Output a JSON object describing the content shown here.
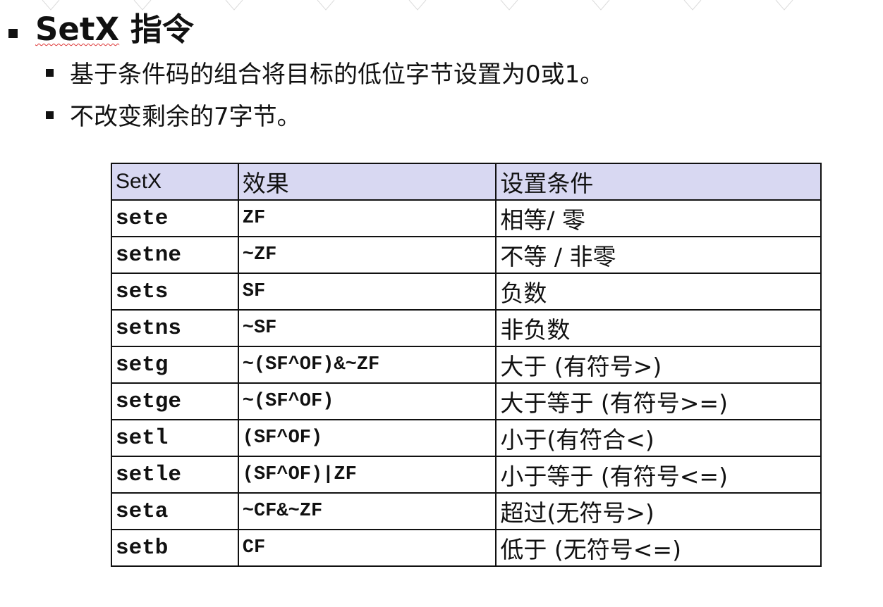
{
  "title": {
    "keyword": "SetX",
    "suffix": "指令"
  },
  "bullets": [
    "基于条件码的组合将目标的低位字节设置为0或1。",
    "不改变剩余的7字节。"
  ],
  "table": {
    "headers": [
      "SetX",
      "效果",
      "设置条件"
    ],
    "rows": [
      [
        "sete",
        "ZF",
        "相等/ 零"
      ],
      [
        "setne",
        "~ZF",
        "不等 / 非零"
      ],
      [
        "sets",
        "SF",
        "负数"
      ],
      [
        "setns",
        "~SF",
        "非负数"
      ],
      [
        "setg",
        "~(SF^OF)&~ZF",
        "大于 (有符号>)"
      ],
      [
        "setge",
        "~(SF^OF)",
        "大于等于 (有符号>=)"
      ],
      [
        "setl",
        "(SF^OF)",
        "小于(有符合<)"
      ],
      [
        "setle",
        "(SF^OF)|ZF",
        "小于等于 (有符号<=)"
      ],
      [
        "seta",
        "~CF&~ZF",
        "超过(无符号>)"
      ],
      [
        "setb",
        "CF",
        "低于 (无符号<=)"
      ]
    ],
    "header_bg": "#d8d8f2"
  }
}
